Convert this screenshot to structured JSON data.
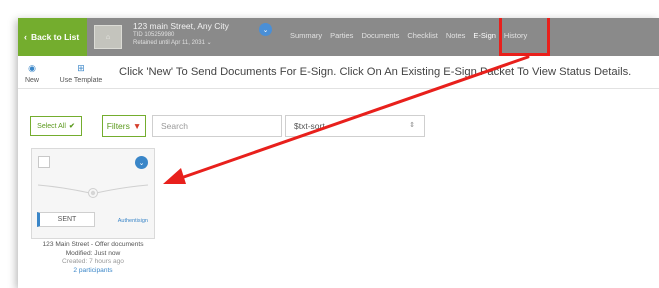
{
  "colors": {
    "accent_green": "#74ad2e",
    "topbar_gray": "#8a8a8a",
    "link_blue": "#3a86c8",
    "annotation_red": "#e8201c"
  },
  "header": {
    "back_label": "Back to List",
    "back_icon": "chevron-left-icon",
    "property_title": "123 main Street, Any City",
    "tid": "TID 105259980",
    "retained": "Retained until Apr 11, 2031",
    "retained_icon": "chevron-down-icon",
    "toggle_icon": "chevron-down-icon"
  },
  "nav": {
    "tabs": [
      {
        "label": "Summary",
        "active": false
      },
      {
        "label": "Parties",
        "active": false
      },
      {
        "label": "Documents",
        "active": false
      },
      {
        "label": "Checklist",
        "active": false
      },
      {
        "label": "Notes",
        "active": false
      },
      {
        "label": "E-Sign",
        "active": true
      },
      {
        "label": "History",
        "active": false
      }
    ]
  },
  "toolbar": {
    "new_label": "New",
    "new_icon": "plus-circle-icon",
    "template_label": "Use Template",
    "template_icon": "grid-icon",
    "instructions": "Click 'New' To Send Documents For E-Sign. Click On An Existing E-Sign Packet To View Status Details."
  },
  "filters": {
    "select_all_label": "Select All",
    "select_all_icon": "checkmark-icon",
    "filters_label": "Filters",
    "filters_icon": "funnel-icon",
    "search_placeholder": "Search",
    "sort_value": "$txt-sort",
    "sort_icon": "up-down-arrows-icon"
  },
  "packets": [
    {
      "status": "SENT",
      "provider": "Authentisign",
      "title": "123 Main Street - Offer documents",
      "modified": "Modified: Just now",
      "created": "Created: 7 hours ago",
      "participants": "2 participants"
    }
  ],
  "annotation": {
    "type": "red box around E-Sign tab with arrow pointing to packet card"
  }
}
